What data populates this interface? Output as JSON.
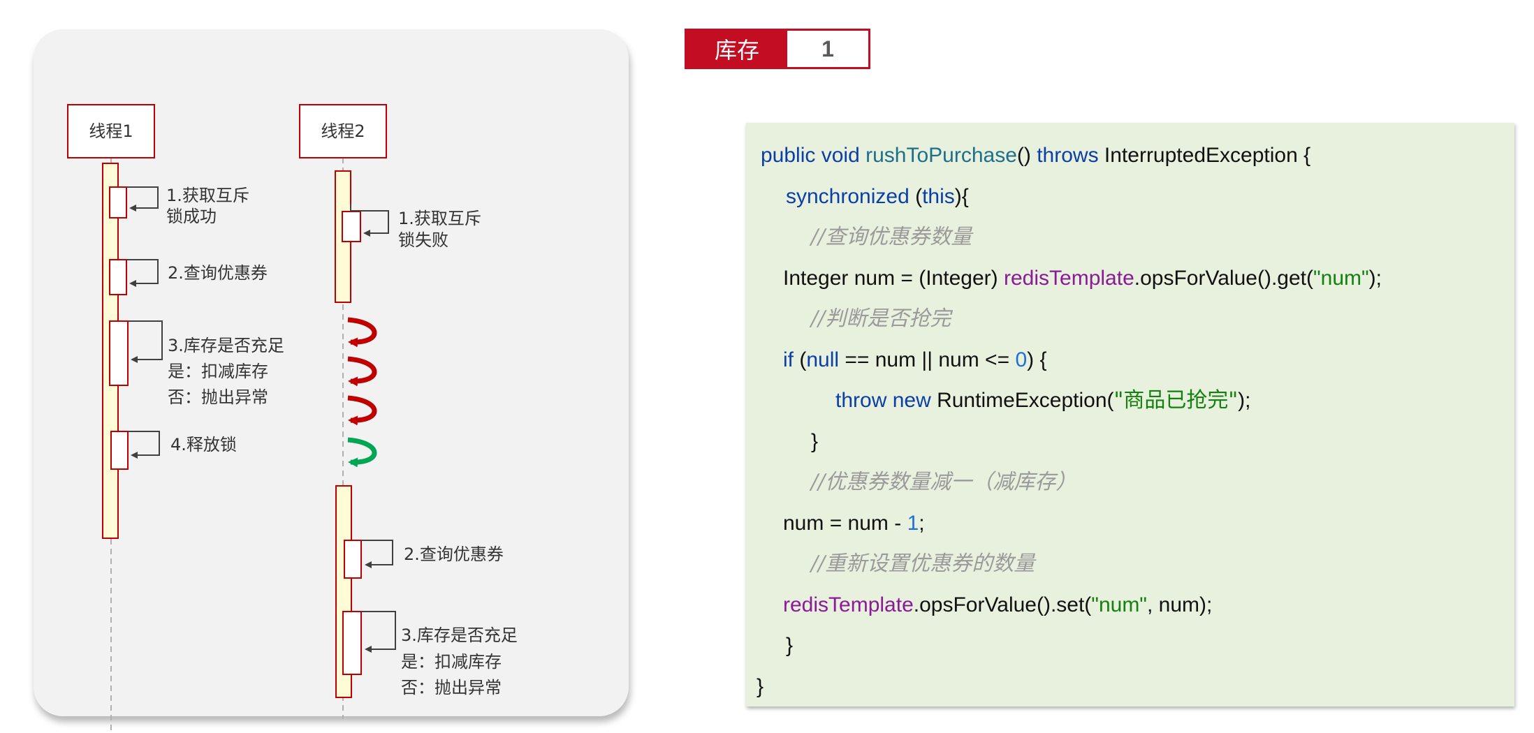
{
  "diagram": {
    "thread1": {
      "title": "线程1",
      "steps": [
        {
          "lines": [
            "1.获取互斥",
            "锁成功"
          ]
        },
        {
          "lines": [
            "2.查询优惠券"
          ]
        },
        {
          "lines": [
            "3.库存是否充足",
            "是：扣减库存",
            "否：抛出异常"
          ]
        },
        {
          "lines": [
            "4.释放锁"
          ]
        }
      ]
    },
    "thread2": {
      "title": "线程2",
      "steps": [
        {
          "lines": [
            "1.获取互斥",
            "锁失败"
          ]
        },
        {
          "lines": [
            "2.查询优惠券"
          ]
        },
        {
          "lines": [
            "3.库存是否充足",
            "是：扣减库存",
            "否：抛出异常"
          ]
        }
      ]
    },
    "retry_arrows": [
      {
        "icon": "retry-arrow-icon",
        "color": "#c00000"
      },
      {
        "icon": "retry-arrow-icon",
        "color": "#c00000"
      },
      {
        "icon": "retry-arrow-icon",
        "color": "#c00000"
      },
      {
        "icon": "success-arrow-icon",
        "color": "#00a651"
      }
    ],
    "colors": {
      "activation_border": "#c00000",
      "activation_fill": "#fffbd6",
      "arrow": "#404040"
    }
  },
  "stock": {
    "label": "库存",
    "value": "1"
  },
  "code": {
    "l1": {
      "kw1": "public void ",
      "fn": "rushToPurchase",
      "t1": "() ",
      "kw2": "throws",
      "t2": " InterruptedException {"
    },
    "l2": {
      "kw1": "synchronized",
      "t1": " (",
      "kw2": "this",
      "t2": "){"
    },
    "l3": {
      "comment": "//查询优惠券数量"
    },
    "l4": {
      "t1": "Integer num = (Integer) ",
      "fld": "redisTemplate",
      "t2": ".opsForValue().get(",
      "str": "\"num\"",
      "t3": ");"
    },
    "l5": {
      "comment": "//判断是否抢完"
    },
    "l6": {
      "kw1": "if",
      "t1": " (",
      "kw2": "null",
      "t2": " == num || num <= ",
      "num": "0",
      "t3": ") {"
    },
    "l7": {
      "kw1": "throw new",
      "t1": " RuntimeException(",
      "str": "\"商品已抢完\"",
      "t2": ");"
    },
    "l8": {
      "t1": "}"
    },
    "l9": {
      "comment": "//优惠券数量减一（减库存）"
    },
    "l10": {
      "t1": "num = num - ",
      "num": "1",
      "t2": ";"
    },
    "l11": {
      "comment": "//重新设置优惠券的数量"
    },
    "l12": {
      "fld": "redisTemplate",
      "t1": ".opsForValue().set(",
      "str": "\"num\"",
      "t2": ", num);"
    },
    "l13": {
      "t1": "}"
    },
    "l14": {
      "t1": "}"
    }
  }
}
